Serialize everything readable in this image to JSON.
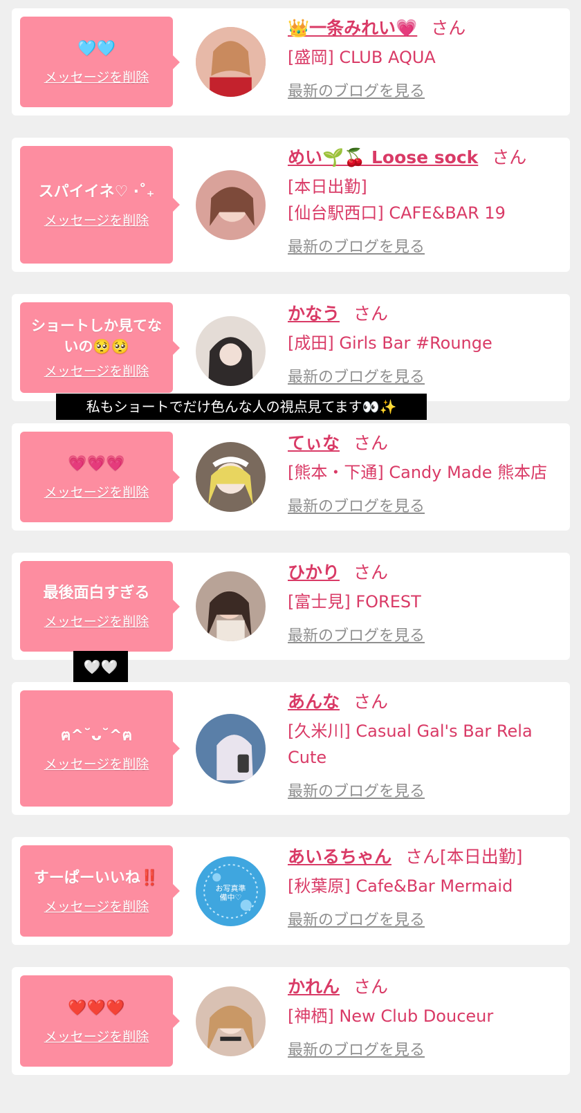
{
  "delete_label": "メッセージを削除",
  "blog_label": "最新のブログを見る",
  "san": "さん",
  "items": [
    {
      "message": "🩵🩵",
      "name": "👑一条みれい💗",
      "san": "さん",
      "lines": [
        "[盛岡] CLUB AQUA"
      ]
    },
    {
      "message": "スパイイネ♡ ‧˚₊",
      "name": "めい🌱🍒 Loose sock",
      "san": "さん",
      "lines": [
        "[本日出勤]",
        "[仙台駅西口] CAFE&BAR 19"
      ]
    },
    {
      "message": "ショートしか見てないの🥺🥺",
      "name": "かなう",
      "san": "さん",
      "lines": [
        "[成田] Girls Bar #Rounge"
      ]
    },
    {
      "message": "💗💗💗",
      "name": "てぃな",
      "san": "さん",
      "lines": [
        "[熊本・下通] Candy Made 熊本店"
      ]
    },
    {
      "message": "最後面白すぎる",
      "name": "ひかり",
      "san": "さん",
      "lines": [
        "[富士見] FOREST"
      ]
    },
    {
      "message": "ฅ^˘ᴗ˘^ฅ",
      "name": "あんな",
      "san": "さん",
      "lines": [
        "[久米川] Casual Gal's Bar Rela",
        "Cute"
      ]
    },
    {
      "message": "すーぱーいいね‼️",
      "name": "あいるちゃん",
      "san": "さん[本日出勤]",
      "lines": [
        "[秋葉原] Cafe&Bar Mermaid"
      ]
    },
    {
      "message": "❤️❤️❤️",
      "name": "かれん",
      "san": "さん",
      "lines": [
        "[神栖] New Club Douceur"
      ]
    }
  ],
  "avatar_placeholder_text": "お写真準備中♡",
  "captions": {
    "caption_1": "私もショートでだけ色んな人の視点見てます👀✨",
    "caption_2": "🤍🤍"
  }
}
